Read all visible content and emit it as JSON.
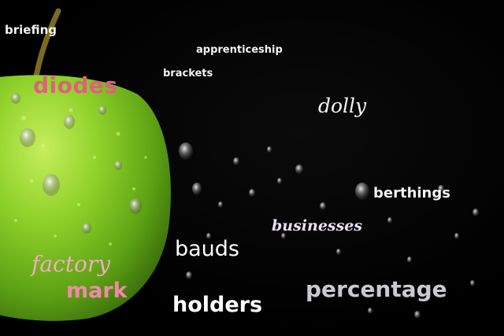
{
  "image": {
    "subject": "green-apple-with-water-drops",
    "background_color": "#000000",
    "apple_color": "#7cc31c"
  },
  "words": {
    "briefing": "briefing",
    "apprenticeship": "apprenticeship",
    "brackets": "brackets",
    "diodes": "diodes",
    "dolly": "dolly",
    "berthings": "berthings",
    "businesses": "businesses",
    "bauds": "bauds",
    "factory": "factory",
    "mark": "mark",
    "percentage": "percentage",
    "holders": "holders"
  }
}
